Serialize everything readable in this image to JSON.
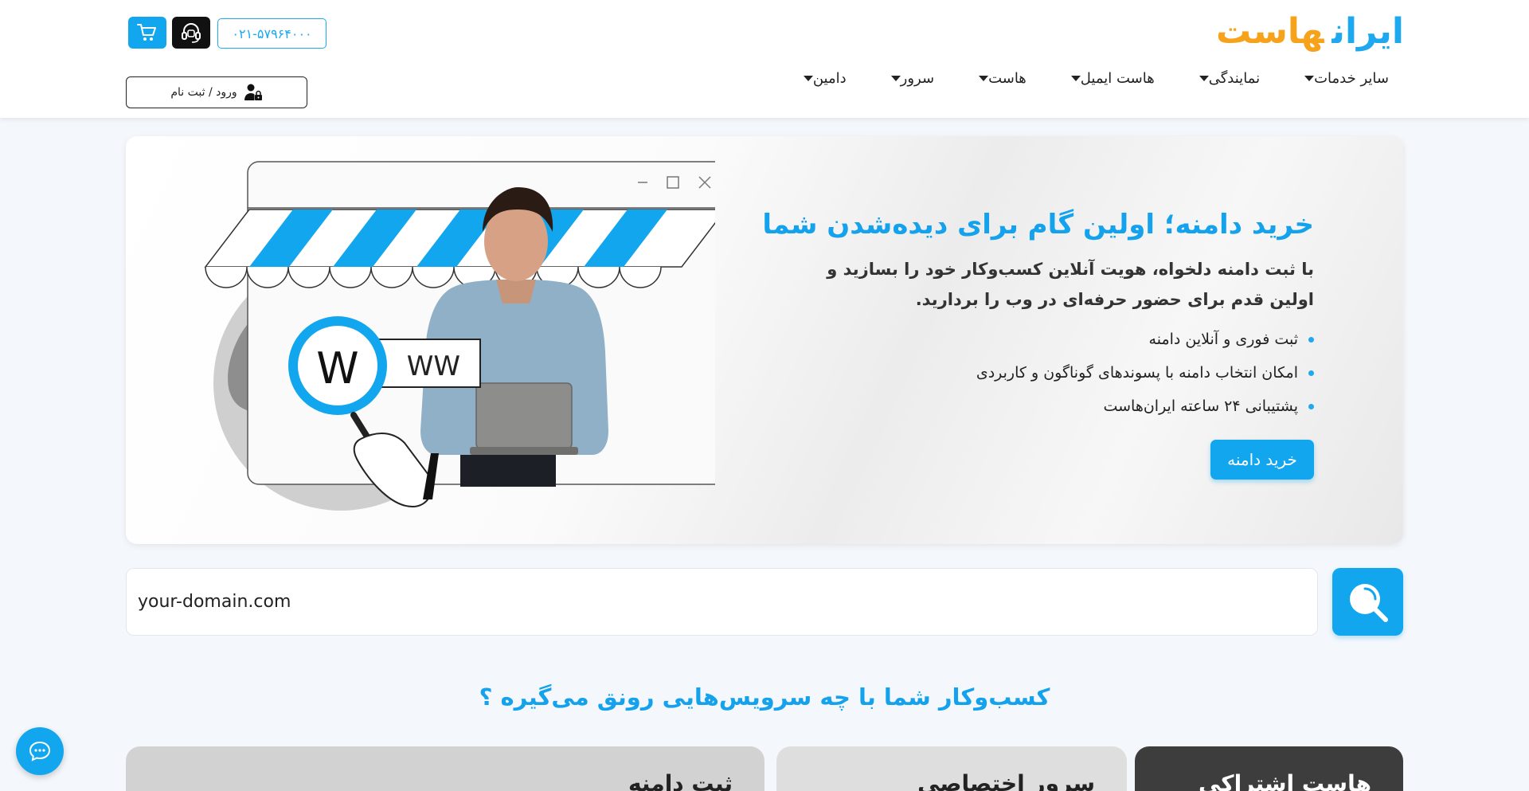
{
  "header": {
    "logo": {
      "part1": "ایران",
      "part2": "هاست"
    },
    "phone": "۰۲۱-۵۷۹۶۴۰۰۰",
    "login_label": "ورود / ثبت نام",
    "nav": [
      {
        "label": "دامین"
      },
      {
        "label": "سرور"
      },
      {
        "label": "هاست"
      },
      {
        "label": "هاست ایمیل"
      },
      {
        "label": "نمایندگی"
      },
      {
        "label": "سایر خدمات"
      }
    ]
  },
  "hero": {
    "title": "خرید دامنه؛ اولین گام برای دیده‌شدن شما",
    "description": "با ثبت دامنه دلخواه، هویت آنلاین کسب‌وکار خود را بسازید و اولین قدم برای حضور حرفه‌ای در وب را بردارید.",
    "bullets": [
      "ثبت فوری و آنلاین دامنه",
      "امکان انتخاب دامنه با پسوندهای گوناگون و کاربردی",
      "پشتیبانی ۲۴ ساعته ایران‌هاست"
    ],
    "cta": "خرید دامنه",
    "art": {
      "www_big": "W",
      "www_small": "WW"
    }
  },
  "search": {
    "placeholder": "your-domain.com"
  },
  "section": {
    "title": "کسب‌وکار شما با چه سرویس‌هایی رونق می‌گیره ؟",
    "cards": [
      {
        "title": "هاست اشتراکی"
      },
      {
        "title": "سرور اختصاصی"
      },
      {
        "title": "ثبت دامنه"
      }
    ]
  },
  "colors": {
    "brand_blue": "#12a6ee",
    "brand_orange": "#f6a21a",
    "dark": "#111111"
  }
}
